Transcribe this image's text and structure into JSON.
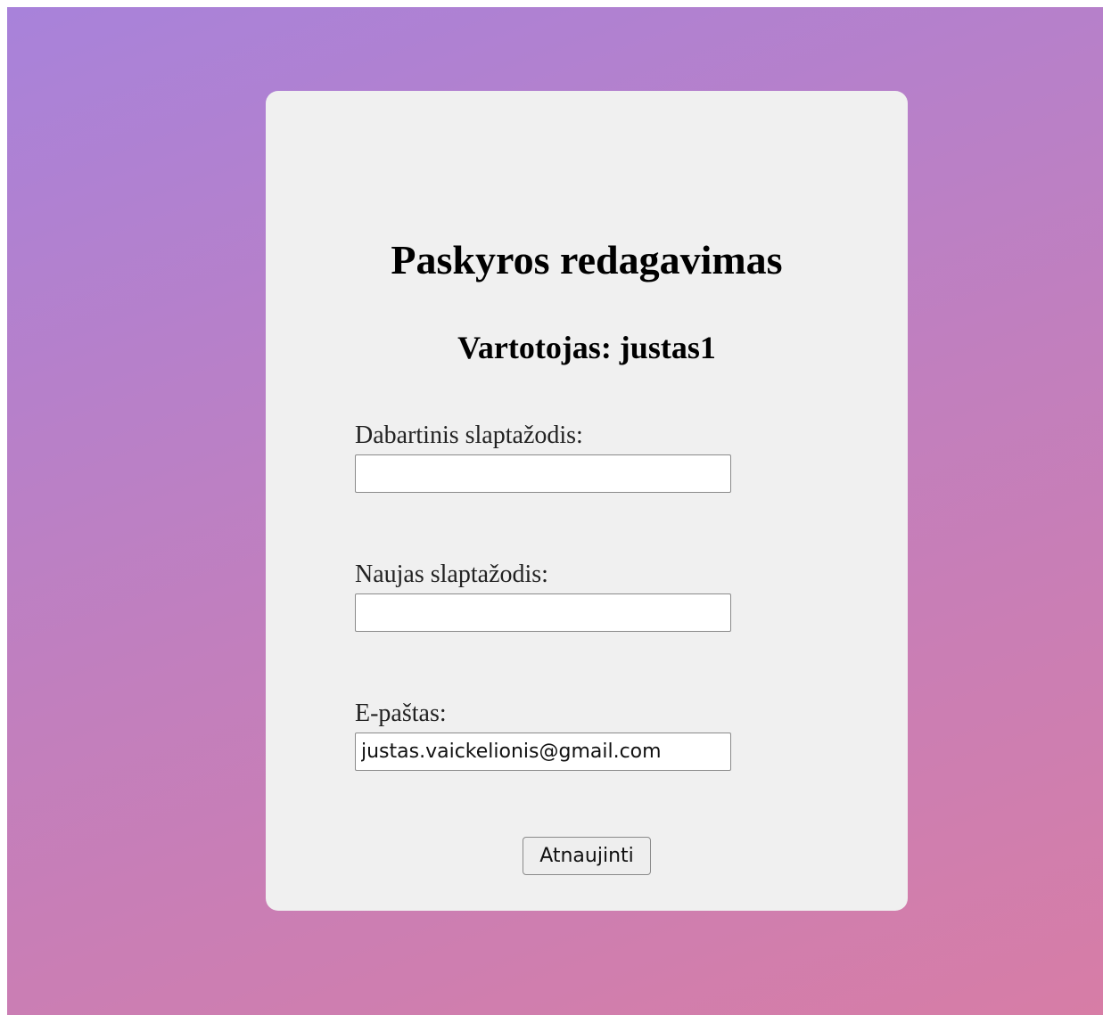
{
  "header": {
    "title": "Paskyros redagavimas",
    "user_line": "Vartotojas: justas1"
  },
  "form": {
    "current_password": {
      "label": "Dabartinis slaptažodis:",
      "value": ""
    },
    "new_password": {
      "label": "Naujas slaptažodis:",
      "value": ""
    },
    "email": {
      "label": "E-paštas:",
      "value": "justas.vaickelionis@gmail.com"
    },
    "submit_label": "Atnaujinti"
  }
}
